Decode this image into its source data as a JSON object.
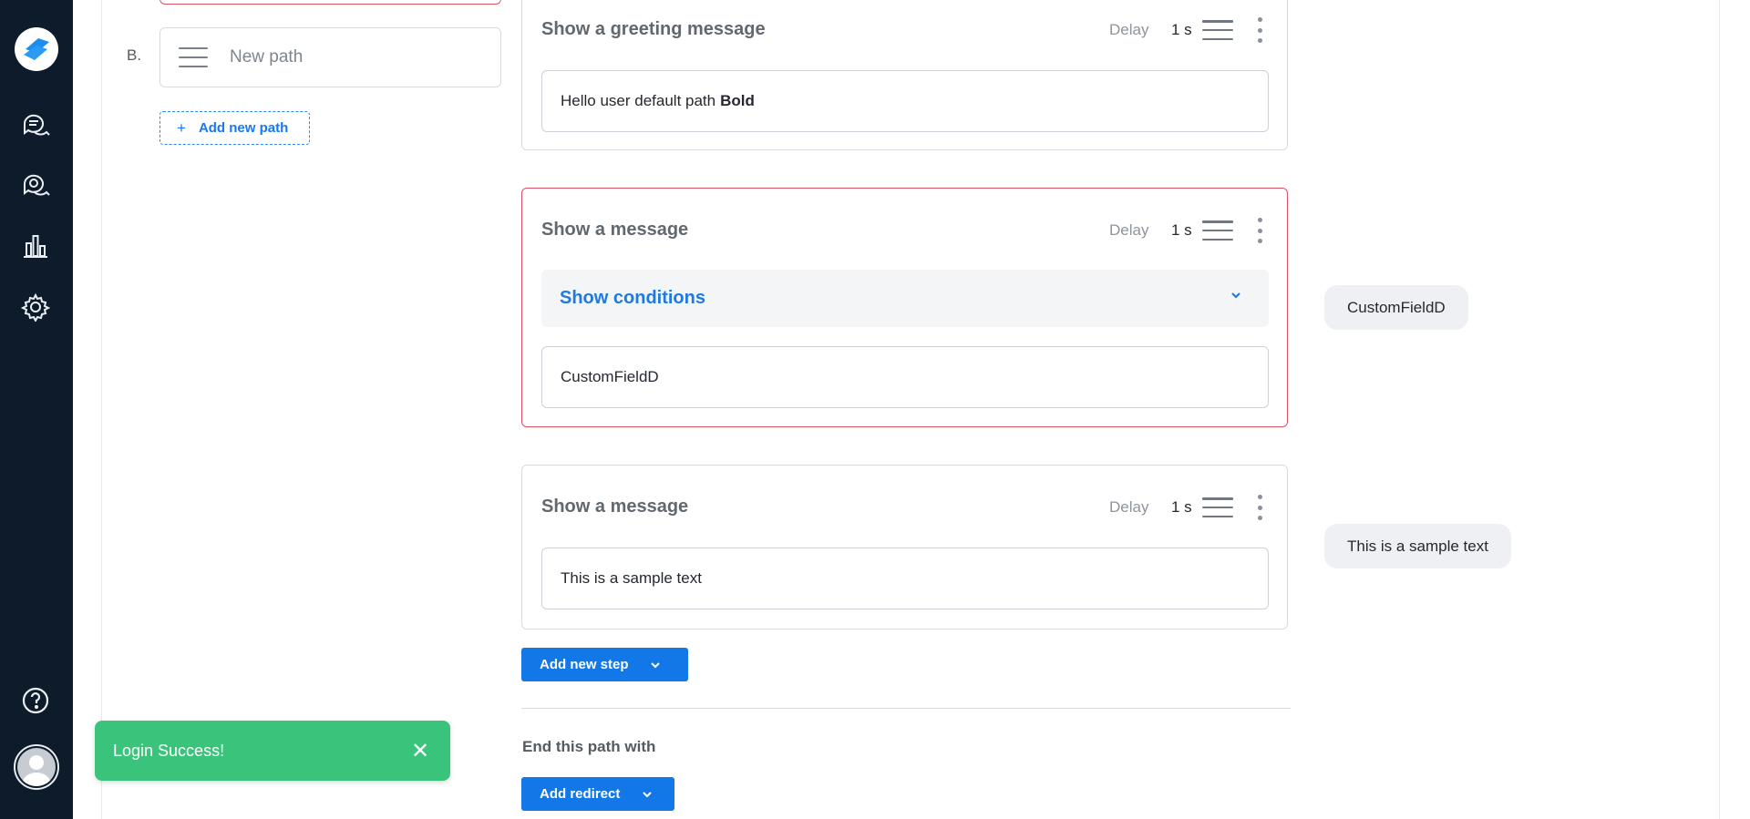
{
  "sidebar": {
    "logo_icon": "app-logo-icon",
    "items": [
      {
        "name": "conversations-icon"
      },
      {
        "name": "bot-chat-icon"
      },
      {
        "name": "analytics-icon"
      },
      {
        "name": "settings-icon"
      }
    ],
    "help_icon": "help-icon",
    "avatar_icon": "avatar-icon",
    "bg_color": "#0d1b2a"
  },
  "paths": {
    "letter": "B.",
    "new_path_label": "New path",
    "add_new_path_label": "Add new path"
  },
  "steps": [
    {
      "title": "Show a greeting message",
      "delay_label": "Delay",
      "delay_value": "1 s",
      "message_text": "Hello user default path",
      "message_bold": "Bold",
      "error": false
    },
    {
      "title": "Show a message",
      "delay_label": "Delay",
      "delay_value": "1 s",
      "conditions_label": "Show conditions",
      "message_text": "CustomFieldD",
      "error": true
    },
    {
      "title": "Show a message",
      "delay_label": "Delay",
      "delay_value": "1 s",
      "message_text": "This is a sample text",
      "error": false
    }
  ],
  "preview": {
    "bubble_1": "CustomFieldD",
    "bubble_2": "This is a sample text"
  },
  "actions": {
    "add_new_step_label": "Add new step",
    "end_path_label": "End this path with",
    "add_redirect_label": "Add redirect"
  },
  "toast": {
    "message": "Login Success!",
    "close_glyph": "✕",
    "color": "#3ac37a"
  },
  "colors": {
    "accent": "#1278e8",
    "error_border": "#e04f63"
  }
}
